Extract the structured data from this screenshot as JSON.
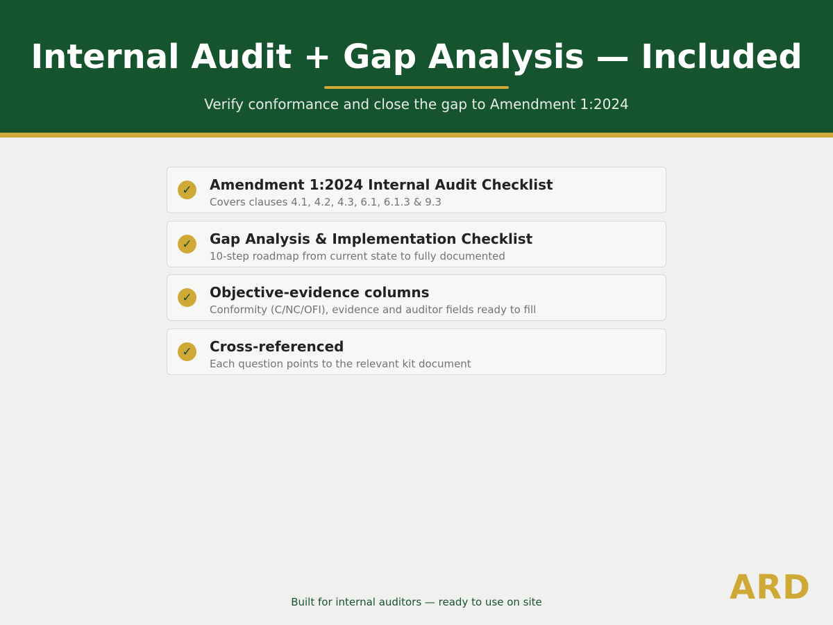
{
  "header": {
    "title": "Internal Audit + Gap Analysis — Included",
    "subtitle": "Verify conformance and close the gap to Amendment 1:2024"
  },
  "features": [
    {
      "icon": "check-icon",
      "title": "Amendment 1:2024 Internal Audit Checklist",
      "description": "Covers clauses 4.1, 4.2, 4.3, 6.1, 6.1.3 & 9.3"
    },
    {
      "icon": "check-icon",
      "title": "Gap Analysis & Implementation Checklist",
      "description": "10-step roadmap from current state to fully documented"
    },
    {
      "icon": "check-icon",
      "title": "Objective-evidence columns",
      "description": "Conformity (C/NC/OFI), evidence and auditor fields ready to fill"
    },
    {
      "icon": "check-icon",
      "title": "Cross-referenced",
      "description": "Each question points to the relevant kit document"
    }
  ],
  "footer": {
    "note": "Built for internal auditors — ready to use on site",
    "logo": "ARD"
  },
  "colors": {
    "header_bg": "#16532f",
    "accent_gold": "#cfa935",
    "page_bg": "#f0f1ee"
  }
}
